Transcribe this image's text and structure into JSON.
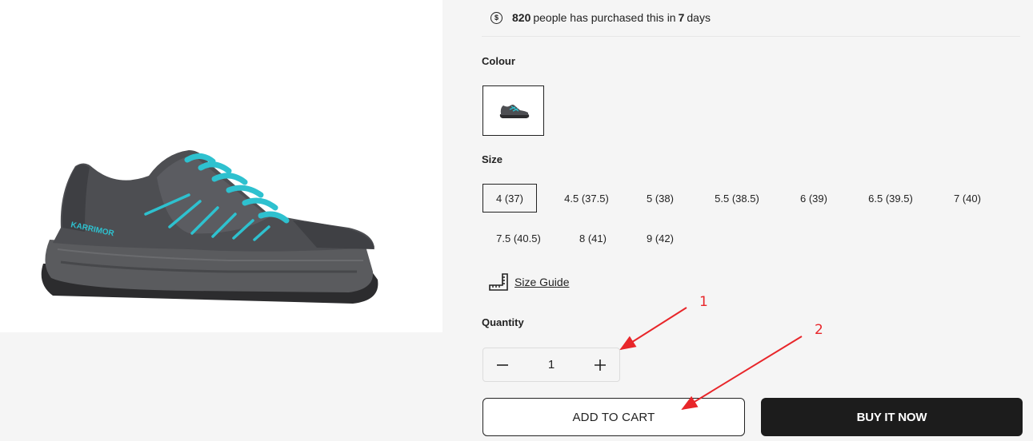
{
  "product": {
    "image_alt": "Karrimor trail running shoe",
    "brand_print": "KARRIMOR",
    "colors": {
      "upper": "#4d4e52",
      "sole": "#56575a",
      "accent": "#2ec1cf",
      "dark": "#2c2c2e"
    }
  },
  "purchase_info": {
    "icon": "dollar-coin-icon",
    "count": "820",
    "text": "people has purchased this in",
    "days": "7",
    "days_suffix": "days"
  },
  "colour_section": {
    "label": "Colour"
  },
  "size_section": {
    "label": "Size",
    "options": [
      "4 (37)",
      "4.5 (37.5)",
      "5 (38)",
      "5.5 (38.5)",
      "6 (39)",
      "6.5 (39.5)",
      "7 (40)",
      "7.5 (40.5)",
      "8 (41)",
      "9 (42)"
    ],
    "selected": "4 (37)"
  },
  "size_guide": {
    "label": "Size Guide",
    "icon": "ruler-icon"
  },
  "quantity": {
    "label": "Quantity",
    "value": "1",
    "minus_icon": "minus-icon",
    "plus_icon": "plus-icon"
  },
  "actions": {
    "add_to_cart": "ADD TO CART",
    "buy_now": "BUY IT NOW"
  },
  "annotations": {
    "marker_1": "1",
    "marker_2": "2",
    "color": "#e8262a"
  }
}
